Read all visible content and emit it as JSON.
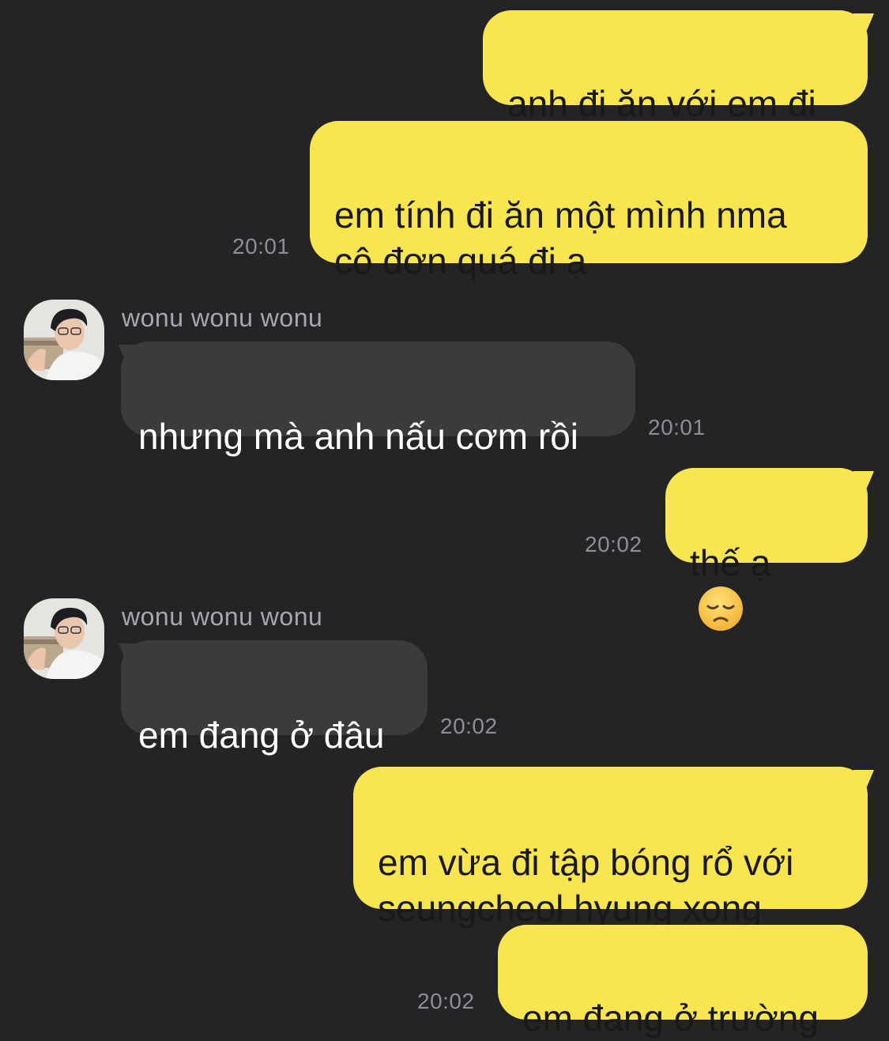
{
  "colors": {
    "background": "#242426",
    "outgoing_bubble": "#F9E54F",
    "incoming_bubble": "#3B3B3D",
    "timestamp": "#8E8E93",
    "sender_name": "#A7A7AB"
  },
  "messages": [
    {
      "side": "out",
      "text": "anh đi ăn với em đi"
    },
    {
      "side": "out",
      "text": "em tính đi ăn một mình nma\ncô đơn quá đi ạ",
      "time": "20:01"
    },
    {
      "side": "in",
      "sender": "wonu wonu wonu",
      "text": "nhưng mà anh nấu cơm rồi",
      "time": "20:01",
      "avatar_icon": "profile-photo-icon"
    },
    {
      "side": "out",
      "text": "thế ạ",
      "emoji": "disappointed-face-icon",
      "time": "20:02"
    },
    {
      "side": "in",
      "sender": "wonu wonu wonu",
      "text": "em đang ở đâu",
      "time": "20:02",
      "avatar_icon": "profile-photo-icon"
    },
    {
      "side": "out",
      "text": "em vừa đi tập bóng rổ với\nseungcheol hyung xong"
    },
    {
      "side": "out",
      "text": "em đang ở trường",
      "time": "20:02"
    }
  ]
}
